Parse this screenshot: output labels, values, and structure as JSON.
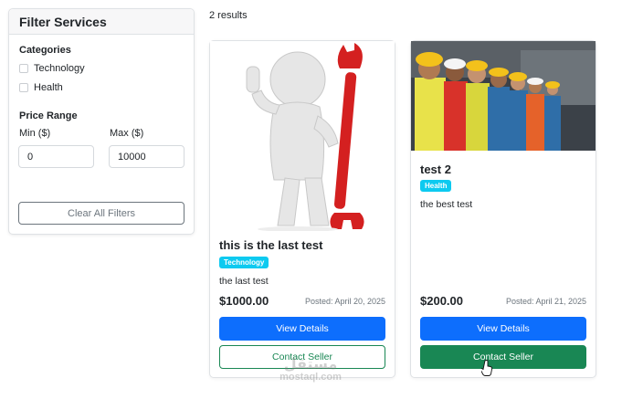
{
  "sidebar": {
    "title": "Filter Services",
    "categories_title": "Categories",
    "categories": [
      "Technology",
      "Health"
    ],
    "price_title": "Price Range",
    "min_label": "Min ($)",
    "max_label": "Max ($)",
    "min_value": "0",
    "max_value": "10000",
    "clear_label": "Clear All Filters"
  },
  "results": {
    "count_text": "2 results"
  },
  "services": [
    {
      "title": "this is the last test",
      "category": "Technology",
      "description": "the last test",
      "price": "$1000.00",
      "posted": "Posted: April 20, 2025",
      "view_label": "View Details",
      "contact_label": "Contact Seller"
    },
    {
      "title": "test 2",
      "category": "Health",
      "description": "the best test",
      "price": "$200.00",
      "posted": "Posted: April 21, 2025",
      "view_label": "View Details",
      "contact_label": "Contact Seller"
    }
  ],
  "watermark": {
    "arabic": "مستقل",
    "latin": "mostaql.com"
  },
  "colors": {
    "primary": "#0d6efd",
    "success": "#198754",
    "badge": "#0dcaf0",
    "muted": "#6c757d"
  }
}
